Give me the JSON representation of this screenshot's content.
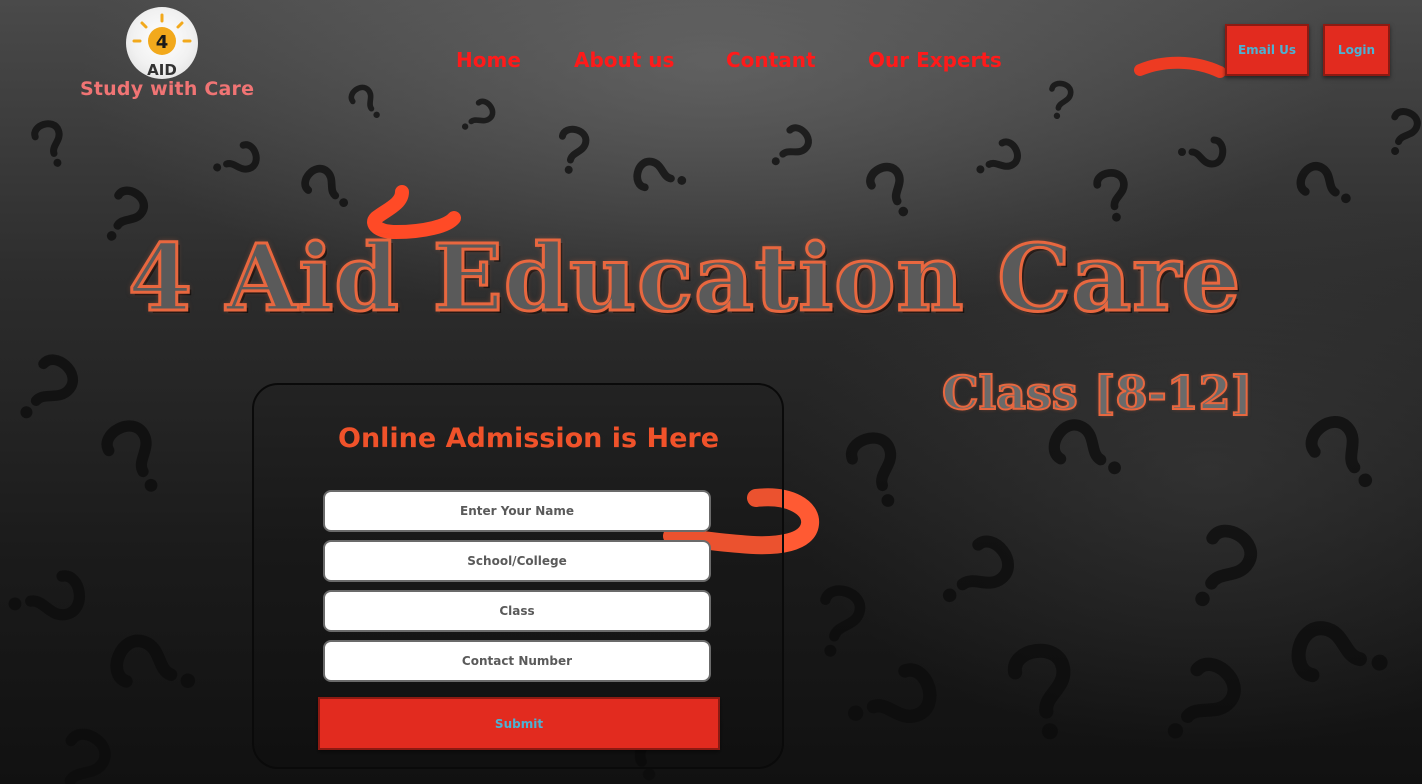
{
  "brand": {
    "logo_text": "4",
    "logo_sub": "AID",
    "tagline": "Study with Care"
  },
  "nav": {
    "items": [
      "Home",
      "About us",
      "Contant",
      "Our Experts"
    ]
  },
  "actions": {
    "email_label": "Email Us",
    "login_label": "Login"
  },
  "hero": {
    "title": "4 Aid Education Care",
    "subtitle": "Class [8-12]"
  },
  "admission_form": {
    "title": "Online Admission is Here",
    "name_placeholder": "Enter Your Name",
    "school_placeholder": "School/College",
    "class_placeholder": "Class",
    "contact_placeholder": "Contact Number",
    "submit_label": "Submit"
  },
  "colors": {
    "accent_red": "#e22b1f",
    "nav_red": "#ff1a1a",
    "hero_orange": "#e8673f",
    "button_text": "#4cb2d4",
    "tagline": "#f07474"
  }
}
